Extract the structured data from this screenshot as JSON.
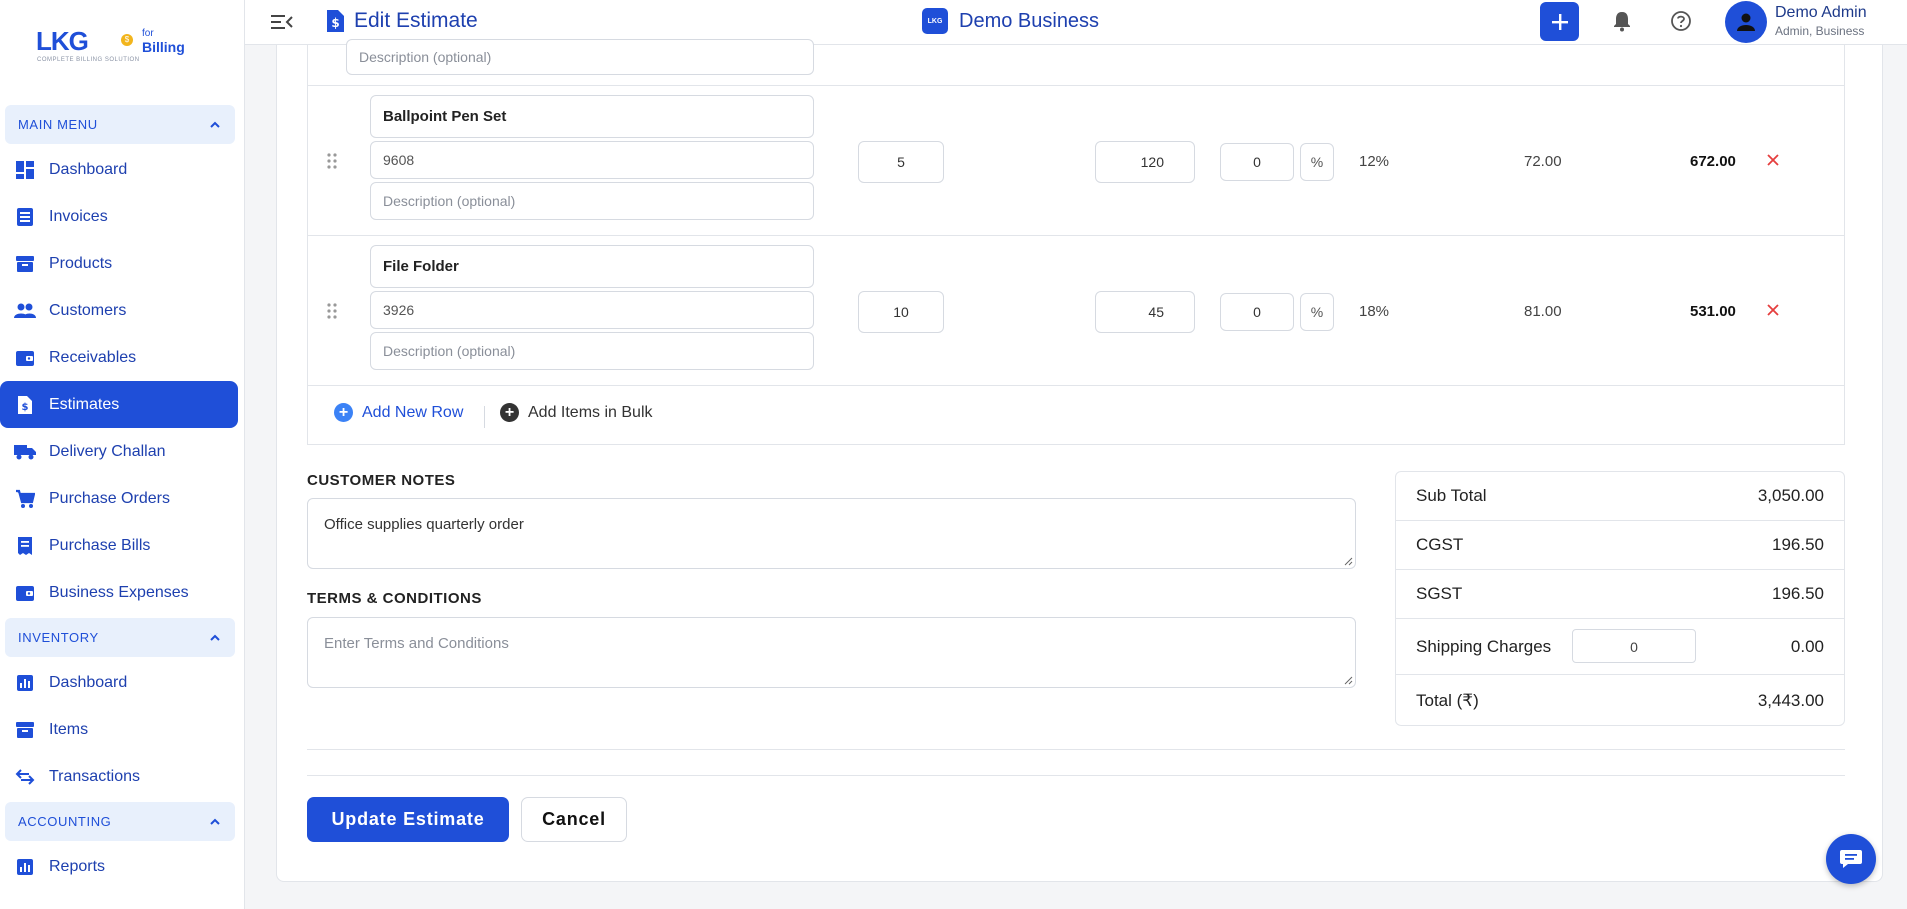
{
  "brand": {
    "logo_text": "LKG",
    "for_text": "for",
    "billing_text": "Billing",
    "tagline": "COMPLETE BILLING SOLUTION",
    "coin_symbol": "$"
  },
  "sidebar": {
    "sections": [
      {
        "title": "MAIN MENU",
        "items": [
          {
            "label": "Dashboard",
            "icon": "dashboard-icon"
          },
          {
            "label": "Invoices",
            "icon": "invoice-icon"
          },
          {
            "label": "Products",
            "icon": "archive-icon"
          },
          {
            "label": "Customers",
            "icon": "people-icon"
          },
          {
            "label": "Receivables",
            "icon": "wallet-icon"
          },
          {
            "label": "Estimates",
            "icon": "estimate-doc-icon",
            "active": true
          },
          {
            "label": "Delivery Challan",
            "icon": "truck-icon"
          },
          {
            "label": "Purchase Orders",
            "icon": "cart-icon"
          },
          {
            "label": "Purchase Bills",
            "icon": "receipt-icon"
          },
          {
            "label": "Business Expenses",
            "icon": "wallet-icon"
          }
        ]
      },
      {
        "title": "INVENTORY",
        "items": [
          {
            "label": "Dashboard",
            "icon": "bar-chart-icon"
          },
          {
            "label": "Items",
            "icon": "archive-icon"
          },
          {
            "label": "Transactions",
            "icon": "swap-icon"
          }
        ]
      },
      {
        "title": "ACCOUNTING",
        "items": [
          {
            "label": "Reports",
            "icon": "bar-chart-icon"
          }
        ]
      }
    ]
  },
  "header": {
    "title": "Edit Estimate",
    "business_logo_text": "LKG",
    "business_name": "Demo Business",
    "user_name": "Demo Admin",
    "user_role": "Admin, Business"
  },
  "top_partial": {
    "description_placeholder": "Description (optional)"
  },
  "rows": [
    {
      "name": "Ballpoint Pen Set",
      "hsn": "9608",
      "description_placeholder": "Description (optional)",
      "qty": "5",
      "rate": "120",
      "discount": "0",
      "discount_unit": "%",
      "tax": "12%",
      "tax_amount": "72.00",
      "amount": "672.00"
    },
    {
      "name": "File Folder",
      "hsn": "3926",
      "description_placeholder": "Description (optional)",
      "qty": "10",
      "rate": "45",
      "discount": "0",
      "discount_unit": "%",
      "tax": "18%",
      "tax_amount": "81.00",
      "amount": "531.00"
    }
  ],
  "actions": {
    "add_row": "Add New Row",
    "add_bulk": "Add Items in Bulk"
  },
  "notes": {
    "label": "CUSTOMER NOTES",
    "value": "Office supplies quarterly order"
  },
  "terms": {
    "label": "TERMS & CONDITIONS",
    "placeholder": "Enter Terms and Conditions"
  },
  "summary": {
    "sub_total_label": "Sub Total",
    "sub_total": "3,050.00",
    "cgst_label": "CGST",
    "cgst": "196.50",
    "sgst_label": "SGST",
    "sgst": "196.50",
    "shipping_label": "Shipping Charges",
    "shipping_input": "0",
    "shipping": "0.00",
    "total_label": "Total (₹)",
    "total": "3,443.00"
  },
  "buttons": {
    "update": "Update Estimate",
    "cancel": "Cancel"
  },
  "colors": {
    "primary": "#1f4fd8",
    "danger": "#e53e3e"
  }
}
